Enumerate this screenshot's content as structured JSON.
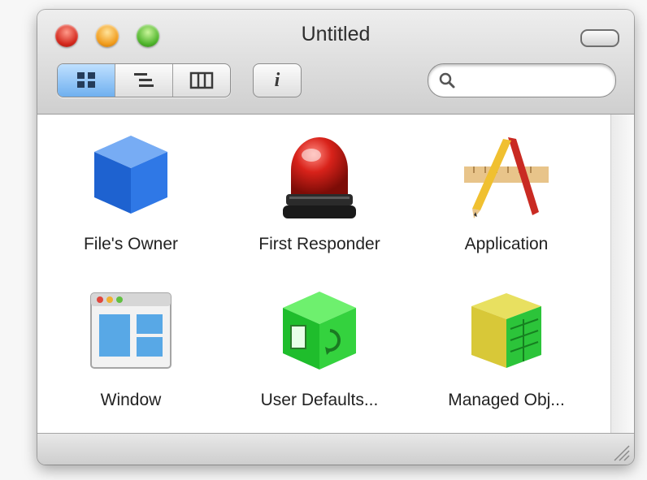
{
  "window": {
    "title": "Untitled"
  },
  "toolbar": {
    "view_modes": [
      "icon-view",
      "list-view",
      "column-view"
    ],
    "active_view": "icon-view",
    "info_label": "i",
    "search_placeholder": ""
  },
  "objects": [
    {
      "label": "File's Owner",
      "icon": "blue-cube-icon"
    },
    {
      "label": "First Responder",
      "icon": "red-siren-icon"
    },
    {
      "label": "Application",
      "icon": "app-pencil-ruler-icon"
    },
    {
      "label": "Window",
      "icon": "window-icon"
    },
    {
      "label": "User Defaults...",
      "icon": "green-cube-icon"
    },
    {
      "label": "Managed Obj...",
      "icon": "managed-object-cube-icon"
    }
  ],
  "colors": {
    "selection_blue": "#6fb0ef",
    "close": "#d2261b",
    "minimize": "#f09a1a",
    "zoom": "#4db32a"
  }
}
